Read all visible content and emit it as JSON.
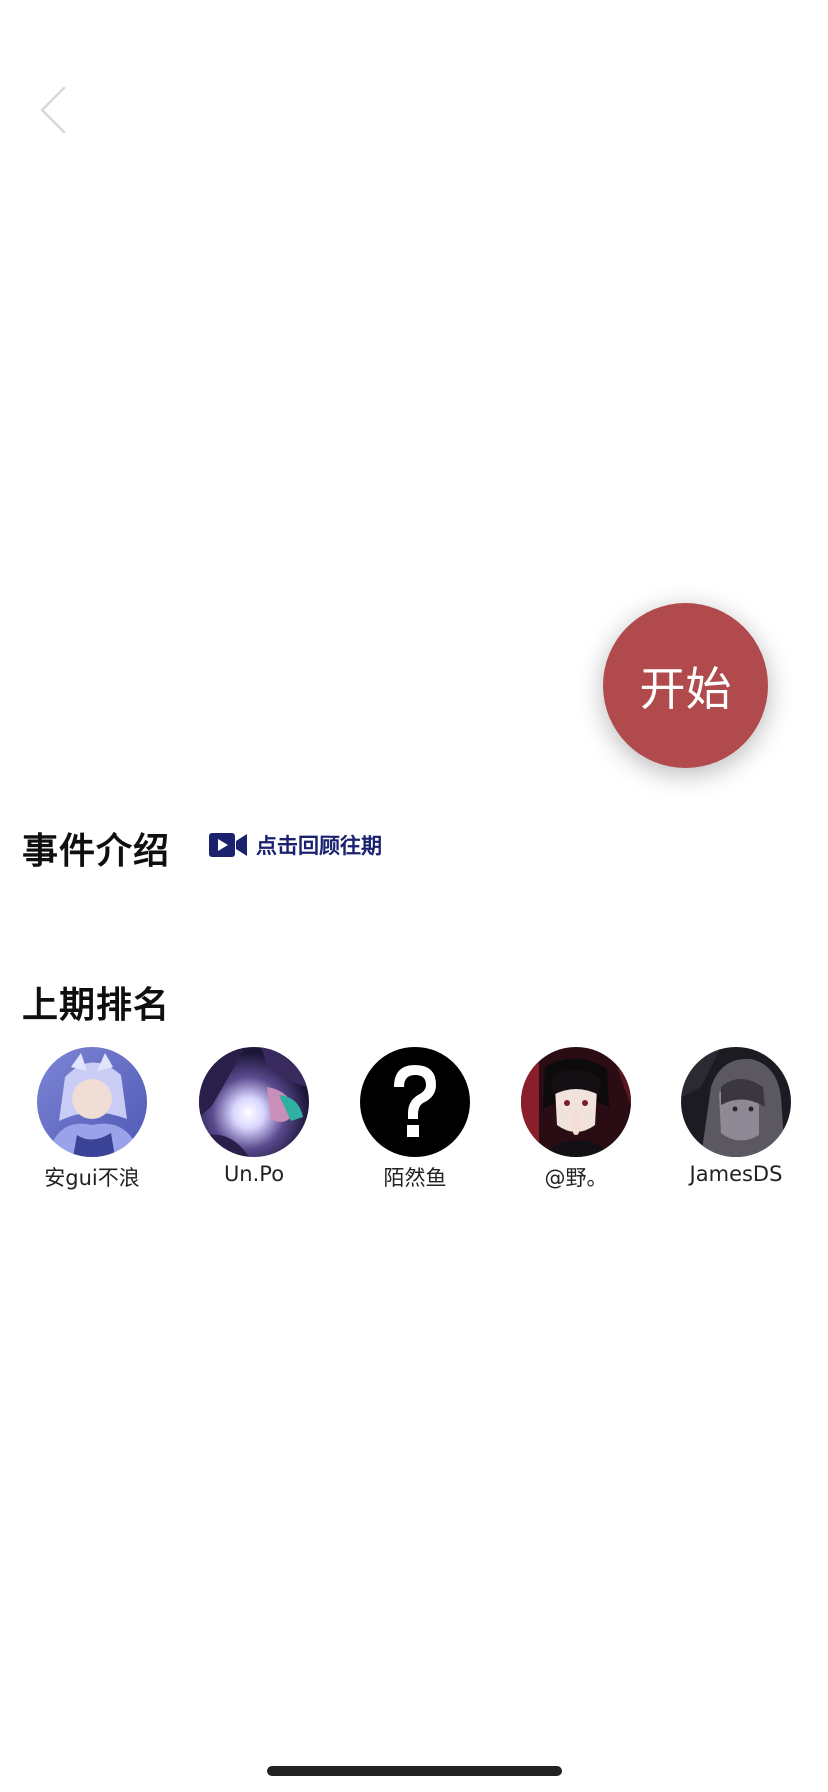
{
  "colors": {
    "accent": "#b04a4c",
    "link": "#1a2270",
    "back_icon": "#d8d8d8"
  },
  "nav": {
    "back_icon": "chevron-left-icon"
  },
  "start_button": {
    "label": "开始"
  },
  "intro": {
    "title": "事件介绍",
    "review_link": {
      "icon": "video-camera-icon",
      "label": "点击回顾往期"
    }
  },
  "ranking": {
    "title": "上期排名",
    "players": [
      {
        "name": "安gui不浪"
      },
      {
        "name": "Un.Po"
      },
      {
        "name": "陌然鱼"
      },
      {
        "name": "@野。"
      },
      {
        "name": "JamesDS"
      }
    ]
  }
}
